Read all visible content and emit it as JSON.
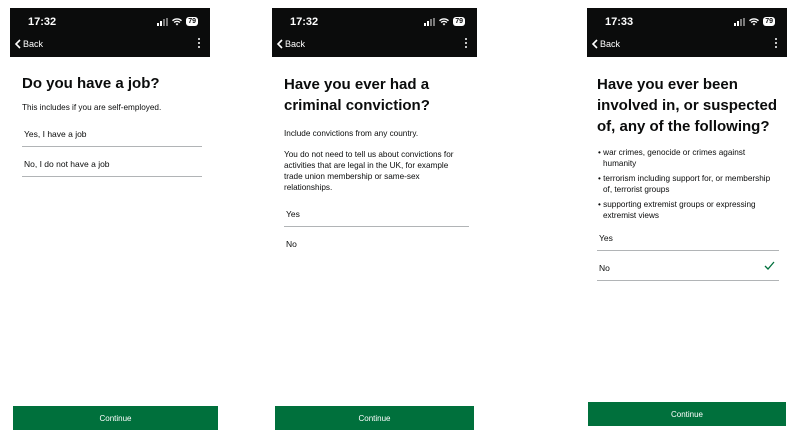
{
  "screens": [
    {
      "status_time": "17:32",
      "battery": "79",
      "back_label": "Back",
      "title": "Do you have a job?",
      "hints": [
        "This includes if you are self-employed."
      ],
      "options": [
        "Yes, I have a job",
        "No, I do not have a job"
      ],
      "selected": null,
      "continue_label": "Continue"
    },
    {
      "status_time": "17:32",
      "battery": "79",
      "back_label": "Back",
      "title": "Have you ever had a criminal conviction?",
      "hints": [
        "Include convictions from any country.",
        "You do not need to tell us about convictions for activities that are legal in the UK, for example trade union membership or same-sex relationships."
      ],
      "options": [
        "Yes",
        "No"
      ],
      "selected": null,
      "continue_label": "Continue"
    },
    {
      "status_time": "17:33",
      "battery": "79",
      "back_label": "Back",
      "title": "Have you ever been involved in, or suspected of, any of the following?",
      "bullets": [
        "war crimes, genocide or crimes against humanity",
        "terrorism including support for, or membership of, terrorist groups",
        "supporting extremist groups or expressing extremist views"
      ],
      "options": [
        "Yes",
        "No"
      ],
      "selected": "No",
      "continue_label": "Continue"
    }
  ],
  "icons": {
    "back": "chevron-left-icon",
    "menu": "kebab-menu-icon",
    "selected": "checkmark-icon"
  },
  "colors": {
    "topbar": "#0b0c0c",
    "continue_button": "#00703c",
    "check": "#00703c"
  }
}
